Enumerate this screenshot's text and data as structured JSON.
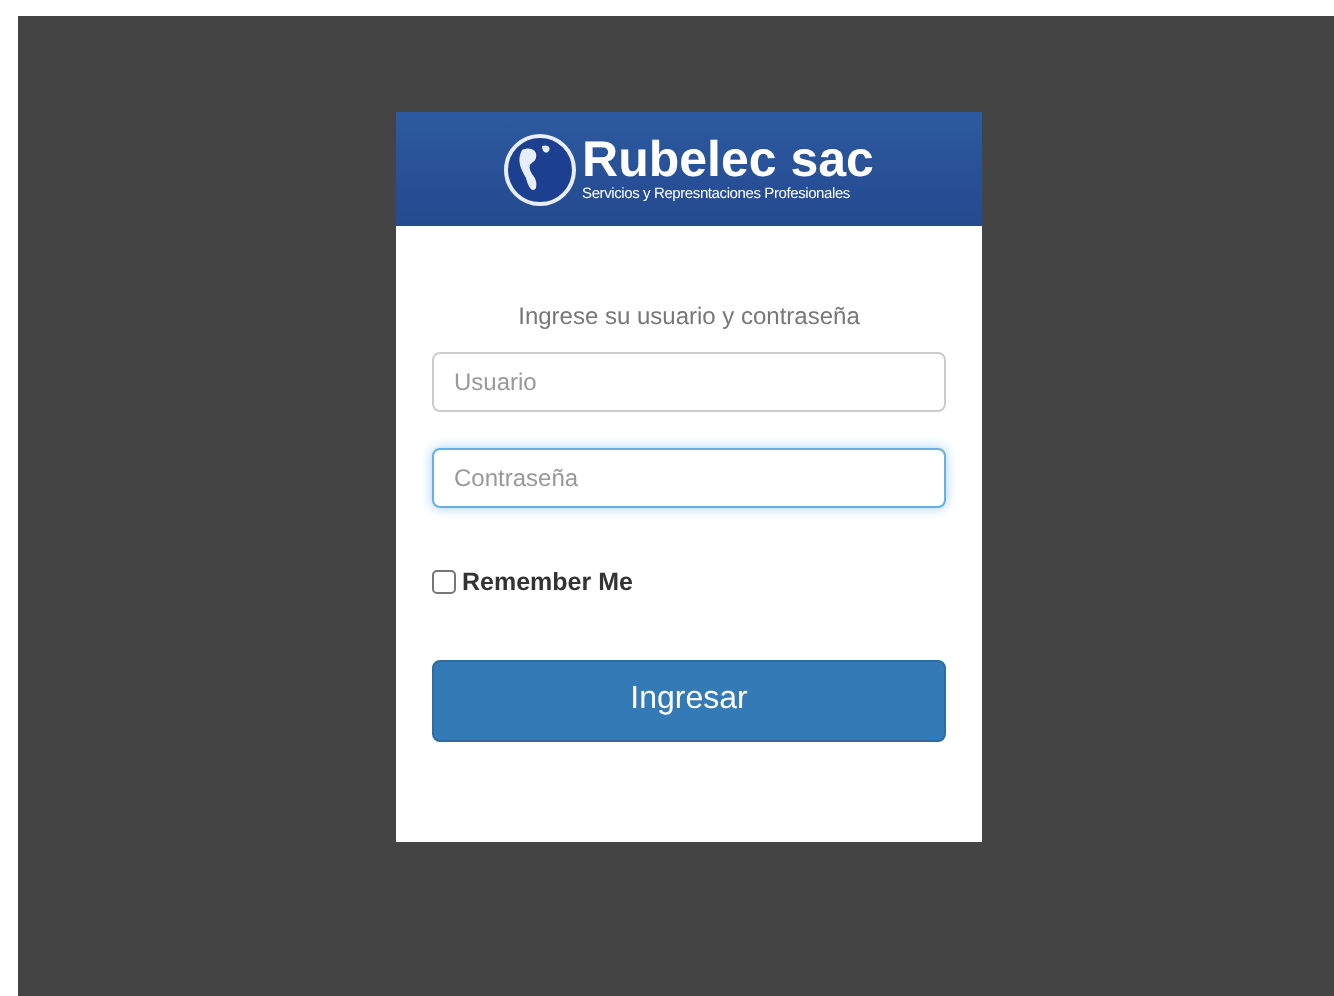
{
  "logo": {
    "name": "Rubelec sac",
    "tagline": "Servicios y Represntaciones Profesionales"
  },
  "prompt": "Ingrese su usuario y contraseña",
  "fields": [
    {
      "placeholder": "Usuario",
      "focused": false
    },
    {
      "placeholder": "Contraseña",
      "focused": true
    }
  ],
  "remember": {
    "label": "Remember Me",
    "checked": false
  },
  "submit": "Ingresar"
}
